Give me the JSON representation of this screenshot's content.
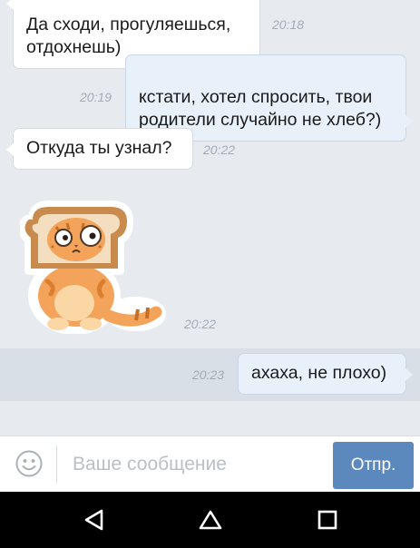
{
  "messages": [
    {
      "text": "Да сходи, прогуляешься,\nотдохнешь)",
      "time": "20:18",
      "direction": "in"
    },
    {
      "text": "кстати, хотел спросить, твои\nродители случайно не хлеб?)",
      "time": "20:19",
      "direction": "out"
    },
    {
      "text": "Откуда ты узнал?",
      "time": "20:22",
      "direction": "in"
    },
    {
      "sticker": "cat-in-bread-slice-sticker",
      "time": "20:22",
      "direction": "in"
    },
    {
      "text": "ахаха, не плохо)",
      "time": "20:23",
      "direction": "out"
    }
  ],
  "composer": {
    "placeholder": "Ваше сообщение",
    "value": "",
    "send_label": "Отпр.",
    "emoji_icon": "smiley-icon"
  },
  "navbar": {
    "icons": [
      "back-triangle-icon",
      "home-icon",
      "recents-square-icon"
    ]
  },
  "colors": {
    "background": "#e7ebf0",
    "bubble_in": "#ffffff",
    "bubble_out": "#e8f1fa",
    "accent": "#5b88bd",
    "timestamp": "#a3acb6"
  }
}
